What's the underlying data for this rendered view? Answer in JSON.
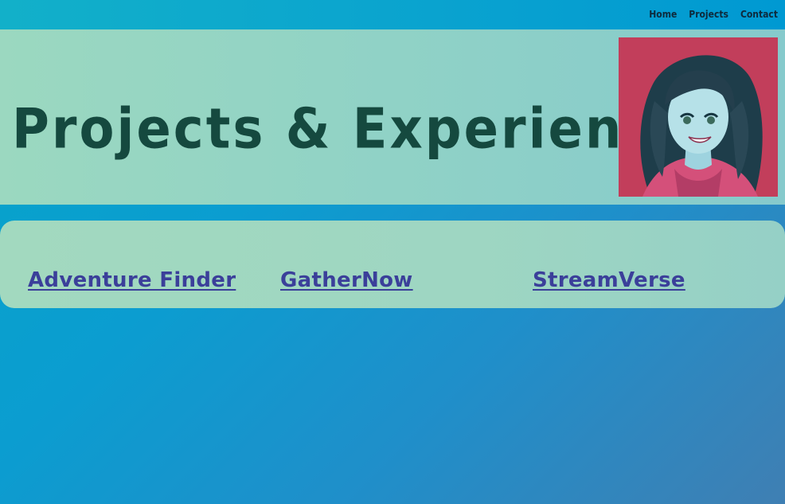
{
  "nav": {
    "items": [
      {
        "label": "Home"
      },
      {
        "label": "Projects"
      },
      {
        "label": "Contact"
      }
    ]
  },
  "hero": {
    "title": "Projects & Experience"
  },
  "projects": {
    "items": [
      {
        "label": "Adventure Finder"
      },
      {
        "label": "GatherNow"
      },
      {
        "label": "StreamVerse"
      }
    ]
  },
  "colors": {
    "page_gradient_start": "#06a5c9",
    "page_gradient_end": "#3f7fb3",
    "band_mint": "#9bd8c0",
    "title_green": "#15493f",
    "link_indigo": "#3b3f9a",
    "avatar_bg": "#c23e5b"
  }
}
